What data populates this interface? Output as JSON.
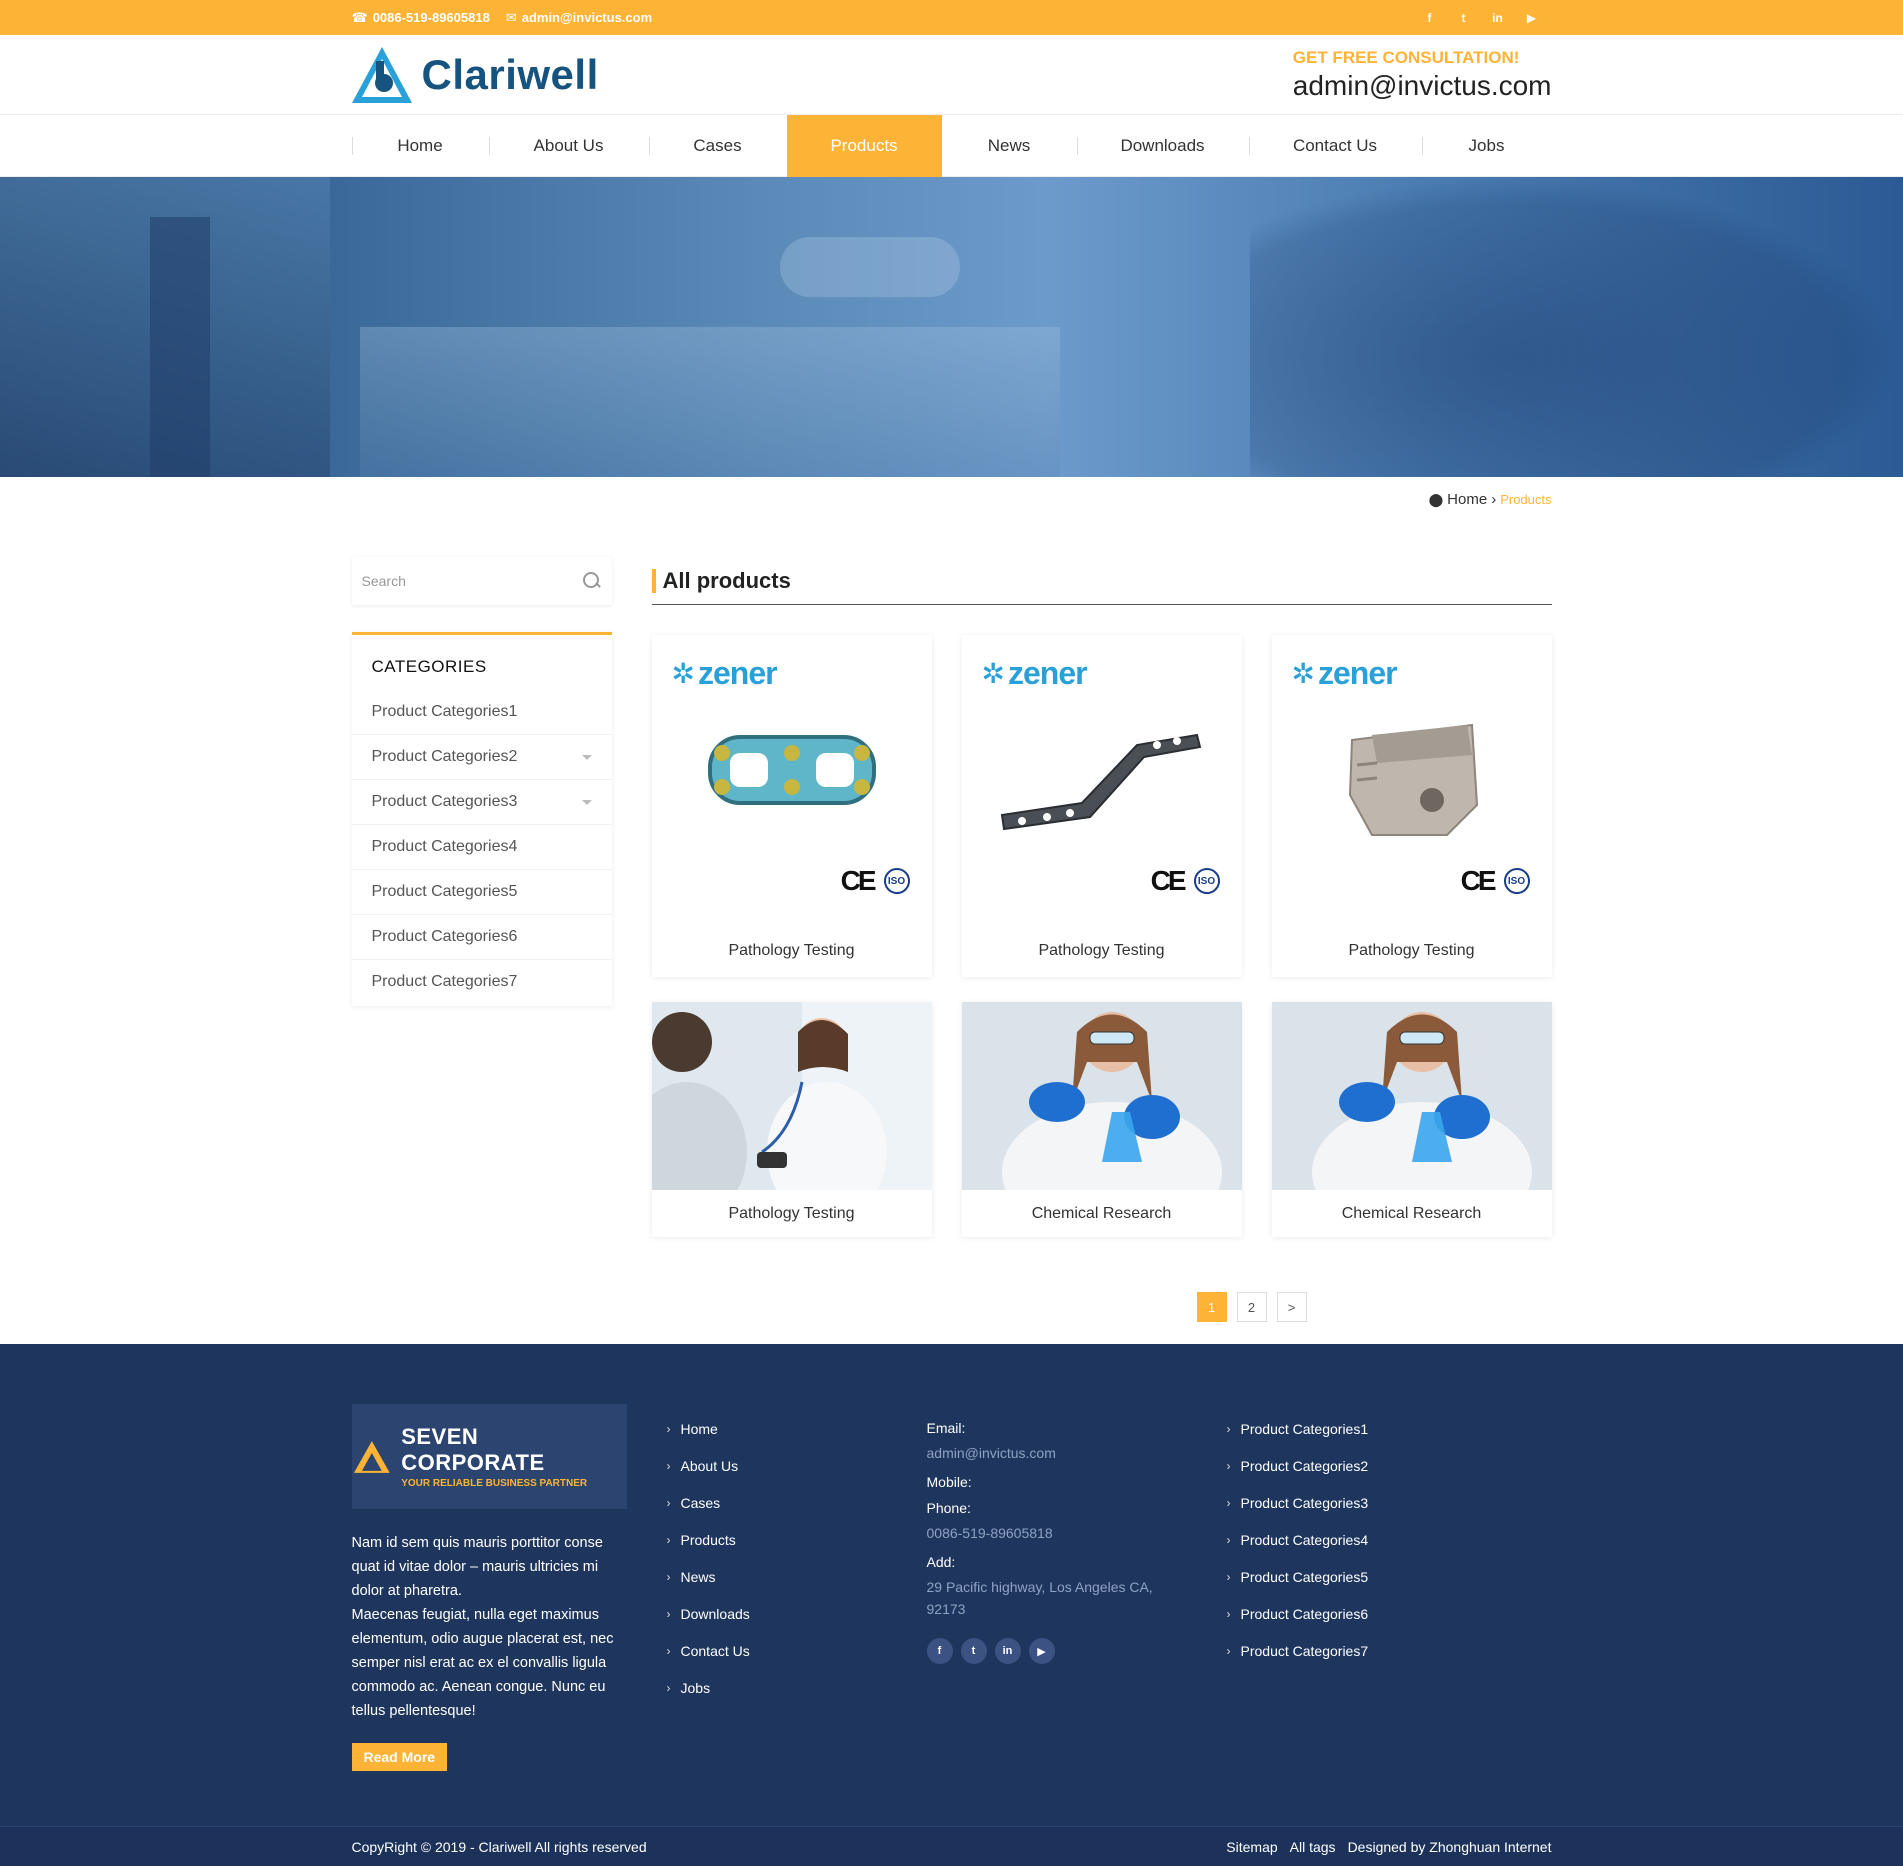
{
  "topbar": {
    "phone": "0086-519-89605818",
    "email": "admin@invictus.com",
    "social": [
      "facebook-icon",
      "twitter-icon",
      "linkedin-icon",
      "youtube-icon"
    ]
  },
  "header": {
    "logo_text": "Clariwell",
    "consult_label": "GET FREE CONSULTATION!",
    "consult_email": "admin@invictus.com"
  },
  "nav": {
    "items": [
      {
        "label": "Home"
      },
      {
        "label": "About Us"
      },
      {
        "label": "Cases"
      },
      {
        "label": "Products",
        "active": true
      },
      {
        "label": "News"
      },
      {
        "label": "Downloads"
      },
      {
        "label": "Contact Us"
      },
      {
        "label": "Jobs"
      }
    ]
  },
  "breadcrumb": {
    "home": "Home",
    "separator": "›",
    "current": "Products"
  },
  "sidebar": {
    "search_placeholder": "Search",
    "categories_title": "CATEGORIES",
    "categories": [
      {
        "label": "Product Categories1",
        "expandable": false
      },
      {
        "label": "Product Categories2",
        "expandable": true
      },
      {
        "label": "Product Categories3",
        "expandable": true
      },
      {
        "label": "Product Categories4",
        "expandable": false
      },
      {
        "label": "Product Categories5",
        "expandable": false
      },
      {
        "label": "Product Categories6",
        "expandable": false
      },
      {
        "label": "Product Categories7",
        "expandable": false
      }
    ]
  },
  "content": {
    "title": "All products",
    "brand": "zener",
    "cert_ce": "CE",
    "cert_iso": "ISO",
    "products": [
      {
        "caption": "Pathology Testing",
        "image": "spinal-plate"
      },
      {
        "caption": "Pathology Testing",
        "image": "bone-plate"
      },
      {
        "caption": "Pathology Testing",
        "image": "cage-implant"
      },
      {
        "caption": "Pathology Testing",
        "image": "doctor-photo"
      },
      {
        "caption": "Chemical Research",
        "image": "lab-photo"
      },
      {
        "caption": "Chemical Research",
        "image": "lab-photo"
      }
    ]
  },
  "pagination": {
    "pages": [
      "1",
      "2"
    ],
    "current": "1",
    "next": ">"
  },
  "footer": {
    "brand_title": "SEVEN CORPORATE",
    "brand_tagline": "YOUR RELIABLE BUSINESS PARTNER",
    "about_p1": "Nam id sem quis mauris porttitor conse quat id vitae dolor – mauris ultricies mi dolor at pharetra.",
    "about_p2": "Maecenas feugiat, nulla eget maximus elementum, odio augue placerat est, nec semper nisl erat ac ex el convallis ligula commodo ac. Aenean congue. Nunc eu tellus pellentesque!",
    "read_more": "Read More",
    "links": [
      "Home",
      "About Us",
      "Cases",
      "Products",
      "News",
      "Downloads",
      "Contact Us",
      "Jobs"
    ],
    "email_label": "Email:",
    "email": "admin@invictus.com",
    "mobile_label": "Mobile:",
    "phone_label": "Phone:",
    "phone": "0086-519-89605818",
    "add_label": "Add:",
    "address": "29 Pacific highway, Los Angeles CA, 92173",
    "categories": [
      "Product Categories1",
      "Product Categories2",
      "Product Categories3",
      "Product Categories4",
      "Product Categories5",
      "Product Categories6",
      "Product Categories7"
    ],
    "copyright": "CopyRight © 2019 -   Clariwell  All rights reserved",
    "sitemap": "Sitemap",
    "all_tags": "All tags",
    "designed_by": "Designed by Zhonghuan Internet"
  },
  "colors": {
    "accent": "#fdb336",
    "brand_blue": "#17537f",
    "footer_bg": "#1e355d"
  }
}
